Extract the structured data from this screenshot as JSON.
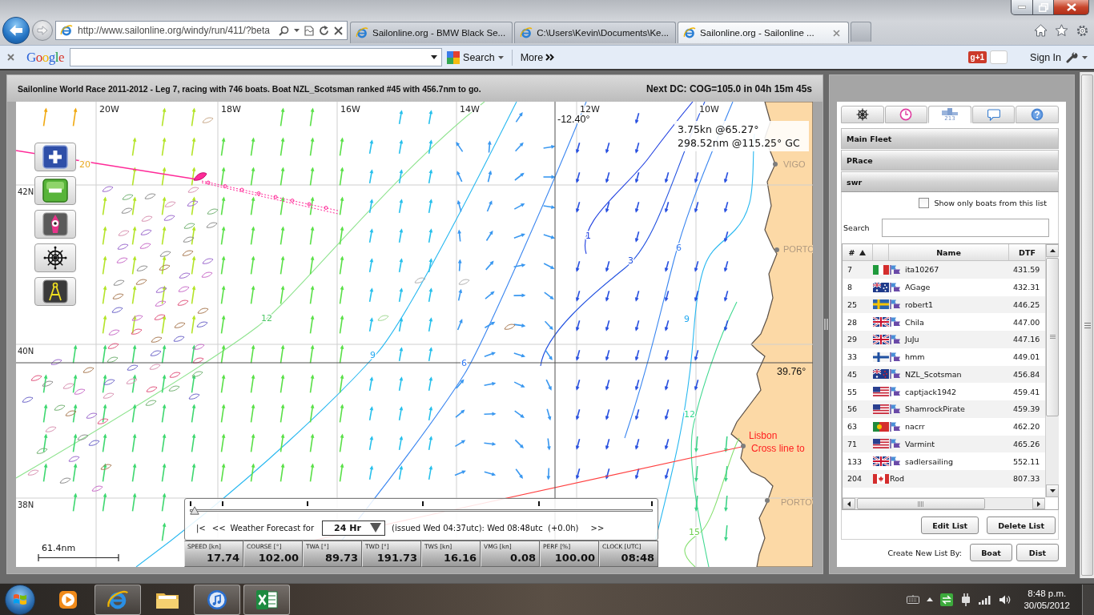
{
  "browser": {
    "address": "http://www.sailonline.org/windy/run/411/?beta",
    "tabs": [
      {
        "label": "Sailonline.org - BMW Black Se...",
        "selected": false
      },
      {
        "label": "C:\\Users\\Kevin\\Documents\\Ke...",
        "selected": false
      },
      {
        "label": "Sailonline.org - Sailonline ...",
        "selected": true
      }
    ]
  },
  "google_bar": {
    "logo": "Google",
    "search_label": "Search",
    "more_label": "More",
    "plus_badge": "g+1",
    "sign_in": "Sign In"
  },
  "race_header": {
    "title": "Sailonline World Race 2011-2012 - Leg 7, racing with 746 boats. Boat NZL_Scotsman ranked #45 with 456.7nm to go.",
    "next_dc": "Next DC: COG=105.0 in 04h 15m 45s"
  },
  "map": {
    "lon_labels": [
      "20W",
      "18W",
      "16W",
      "14W",
      "12W",
      "10W"
    ],
    "lat_labels": [
      "42N",
      "40N",
      "38N"
    ],
    "cursor": {
      "lon": "-12.40°",
      "lat": "39.76°"
    },
    "readout": [
      "3.75kn @65.27°",
      "298.52nm @115.25° GC"
    ],
    "places": [
      {
        "label": "VIGO",
        "kind": "town"
      },
      {
        "label": "PORTO",
        "kind": "town"
      },
      {
        "label": "Lisbon",
        "kind": "finish"
      },
      {
        "label": "Cross line to",
        "kind": "finish"
      },
      {
        "label": "PORTO",
        "kind": "town"
      }
    ],
    "contour_labels": [
      "20",
      "1",
      "6",
      "3",
      "12",
      "9",
      "9",
      "6",
      "12",
      "15"
    ],
    "scale": "61.4nm"
  },
  "forecast": {
    "level": 0,
    "first": "|<",
    "back": "<<",
    "label": "Weather Forecast for",
    "period": "24 Hr",
    "issued": "(issued Wed 04:37utc): Wed 08:48utc  (+0.0h)",
    "forward": ">>"
  },
  "instruments": [
    {
      "label": "SPEED [kn]",
      "value": "17.74"
    },
    {
      "label": "COURSE [°]",
      "value": "102.00"
    },
    {
      "label": "TWA [°]",
      "value": "89.73"
    },
    {
      "label": "TWD [°]",
      "value": "191.73"
    },
    {
      "label": "TWS [kn]",
      "value": "16.16"
    },
    {
      "label": "VMG [kn]",
      "value": "0.08"
    },
    {
      "label": "PERF [%]",
      "value": "100.00"
    },
    {
      "label": "CLOCK [UTC]",
      "value": "08:48"
    }
  ],
  "side_panel": {
    "tabs": [
      {
        "kind": "helm",
        "selected": false
      },
      {
        "kind": "clock",
        "selected": false
      },
      {
        "kind": "fleet",
        "label": "213",
        "selected": true
      },
      {
        "kind": "chat",
        "selected": false
      },
      {
        "kind": "help",
        "selected": false
      }
    ],
    "lists": [
      {
        "label": "Main Fleet",
        "expanded": false
      },
      {
        "label": "PRace",
        "expanded": false
      },
      {
        "label": "swr",
        "expanded": true
      }
    ],
    "filter": {
      "label": "Show only boats from this list",
      "checked": false
    },
    "search": {
      "label": "Search"
    },
    "table": {
      "columns": [
        {
          "label": "#",
          "sorted": true
        },
        {
          "label": "Name",
          "sorted": false
        },
        {
          "label": "DTF",
          "sorted": false
        }
      ],
      "rows": [
        {
          "rank": "7",
          "kind": "italy",
          "pennant": true,
          "name": "ita10267",
          "dtf": "431.59"
        },
        {
          "rank": "8",
          "kind": "australia",
          "pennant": true,
          "name": "AGage",
          "dtf": "432.31"
        },
        {
          "rank": "25",
          "kind": "sweden",
          "pennant": true,
          "name": "robert1",
          "dtf": "446.25"
        },
        {
          "rank": "28",
          "kind": "britain",
          "pennant": true,
          "name": "Chila",
          "dtf": "447.00"
        },
        {
          "rank": "29",
          "kind": "britain",
          "pennant": true,
          "name": "JuJu",
          "dtf": "447.16"
        },
        {
          "rank": "33",
          "kind": "finland",
          "pennant": true,
          "name": "hmm",
          "dtf": "449.01"
        },
        {
          "rank": "45",
          "kind": "newzealand",
          "pennant": true,
          "name": "NZL_Scotsman",
          "dtf": "456.84"
        },
        {
          "rank": "55",
          "kind": "usa",
          "pennant": true,
          "name": "captjack1942",
          "dtf": "459.41"
        },
        {
          "rank": "56",
          "kind": "usa",
          "pennant": true,
          "name": "ShamrockPirate",
          "dtf": "459.39"
        },
        {
          "rank": "63",
          "kind": "portugal",
          "pennant": true,
          "name": "nacrr",
          "dtf": "462.20"
        },
        {
          "rank": "71",
          "kind": "usa",
          "pennant": true,
          "name": "Varmint",
          "dtf": "465.26"
        },
        {
          "rank": "133",
          "kind": "britain",
          "pennant": true,
          "name": "sadlersailing",
          "dtf": "552.11"
        },
        {
          "rank": "204",
          "kind": "canada",
          "pennant": false,
          "name": "Rod",
          "dtf": "807.33"
        }
      ]
    },
    "list_buttons": [
      "Edit List",
      "Delete List"
    ],
    "create": {
      "label": "Create New List By:",
      "buttons": [
        "Boat",
        "Dist"
      ]
    }
  },
  "taskbar": {
    "apps": [
      {
        "kind": "media",
        "running": false
      },
      {
        "kind": "browser",
        "running": true
      },
      {
        "kind": "folder",
        "running": false
      },
      {
        "kind": "music",
        "running": true
      },
      {
        "kind": "spreadsheet",
        "running": true
      }
    ],
    "time": "8:48 p.m.",
    "date": "30/05/2012"
  }
}
